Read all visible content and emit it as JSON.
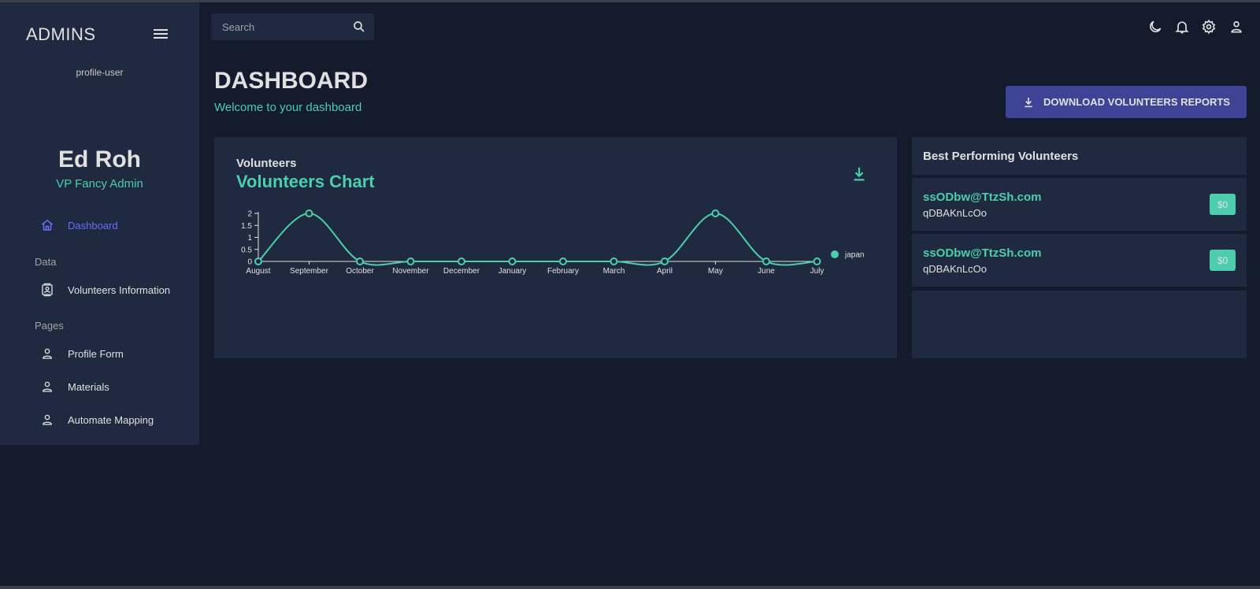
{
  "sidebar": {
    "brand": "ADMINS",
    "avatar_alt": "profile-user",
    "user_name": "Ed Roh",
    "user_role": "VP Fancy Admin",
    "items": [
      {
        "label": "Dashboard",
        "icon": "home-icon",
        "active": true
      },
      {
        "section": "Data"
      },
      {
        "label": "Volunteers Information",
        "icon": "contacts-icon"
      },
      {
        "section": "Pages"
      },
      {
        "label": "Profile Form",
        "icon": "person-icon"
      },
      {
        "label": "Materials",
        "icon": "person-icon"
      },
      {
        "label": "Automate Mapping",
        "icon": "person-icon"
      }
    ]
  },
  "topbar": {
    "search_placeholder": "Search",
    "icons": [
      "dark-mode-icon",
      "notifications-icon",
      "settings-icon",
      "person-icon"
    ]
  },
  "header": {
    "title": "DASHBOARD",
    "subtitle": "Welcome to your dashboard",
    "download_label": "DOWNLOAD VOLUNTEERS REPORTS"
  },
  "chart_panel": {
    "subtitle": "Volunteers",
    "title": "Volunteers Chart"
  },
  "chart_data": {
    "type": "line",
    "title": "",
    "xlabel": "",
    "ylabel": "",
    "categories": [
      "August",
      "September",
      "October",
      "November",
      "December",
      "January",
      "February",
      "March",
      "April",
      "May",
      "June",
      "July"
    ],
    "series": [
      {
        "name": "japan",
        "values": [
          0,
          2,
          0,
          0,
          0,
          0,
          0,
          0,
          0,
          2,
          0,
          0
        ]
      }
    ],
    "yticks": [
      "0",
      "0.5",
      "1",
      "1.5",
      "2"
    ],
    "ylim": [
      0,
      2
    ],
    "legend_position": "right",
    "color": "#4cceac",
    "grid": false
  },
  "best_performing": {
    "title": "Best Performing Volunteers",
    "items": [
      {
        "email": "ssODbw@TtzSh.com",
        "name": "qDBAKnLcOo",
        "amount": "$0"
      },
      {
        "email": "ssODbw@TtzSh.com",
        "name": "qDBAKnLcOo",
        "amount": "$0"
      }
    ]
  },
  "colors": {
    "background": "#141b2d",
    "panel": "#1f2a40",
    "accent": "#4cceac",
    "primary_button": "#3e4396",
    "active_nav": "#6870fa"
  }
}
